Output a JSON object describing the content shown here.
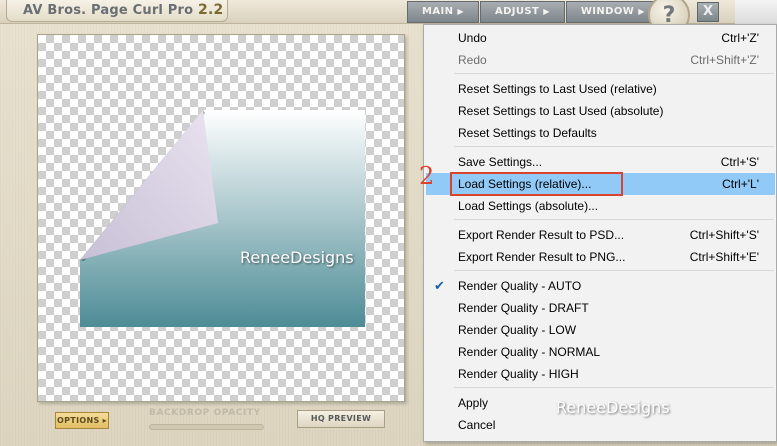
{
  "app": {
    "title": "AV Bros. Page Curl Pro",
    "version": "2.2",
    "menus": [
      {
        "label": "MAIN",
        "arrow": "▶"
      },
      {
        "label": "ADJUST",
        "arrow": "▶"
      },
      {
        "label": "WINDOW",
        "arrow": "▶"
      }
    ],
    "help_glyph": "?",
    "close_glyph": "X"
  },
  "canvas": {
    "watermark": "ReneeDesigns",
    "gradient_top": "#ffffff",
    "gradient_bottom": "#4e8c96",
    "curl_color": "#e9e2ef"
  },
  "bottom_bar": {
    "options_label": "OPTIONS",
    "options_arrow": "▸",
    "backdrop_opacity_label": "BACKDROP OPACITY",
    "hq_preview_label": "HQ PREVIEW"
  },
  "context_menu": {
    "items": [
      {
        "label": "Undo",
        "shortcut": "Ctrl+'Z'",
        "disabled": false
      },
      {
        "label": "Redo",
        "shortcut": "Ctrl+Shift+'Z'",
        "disabled": true
      },
      {
        "label": "Reset Settings to Last Used (relative)",
        "shortcut": ""
      },
      {
        "label": "Reset Settings to Last Used (absolute)",
        "shortcut": ""
      },
      {
        "label": "Reset Settings to Defaults",
        "shortcut": ""
      },
      {
        "label": "Save Settings...",
        "shortcut": "Ctrl+'S'"
      },
      {
        "label": "Load Settings (relative)...",
        "shortcut": "Ctrl+'L'",
        "highlighted": true
      },
      {
        "label": "Load Settings (absolute)...",
        "shortcut": ""
      },
      {
        "label": "Export Render Result to PSD...",
        "shortcut": "Ctrl+Shift+'S'"
      },
      {
        "label": "Export Render Result to PNG...",
        "shortcut": "Ctrl+Shift+'E'"
      },
      {
        "label": "Render Quality - AUTO",
        "shortcut": "",
        "checked": true
      },
      {
        "label": "Render Quality - DRAFT",
        "shortcut": ""
      },
      {
        "label": "Render Quality - LOW",
        "shortcut": ""
      },
      {
        "label": "Render Quality - NORMAL",
        "shortcut": ""
      },
      {
        "label": "Render Quality - HIGH",
        "shortcut": ""
      },
      {
        "label": "Apply",
        "shortcut": ""
      },
      {
        "label": "Cancel",
        "shortcut": ""
      }
    ],
    "check_glyph": "✔",
    "highlight_color": "#91c9f7"
  },
  "annotation": {
    "step_number": "2",
    "color": "#d84430",
    "watermark": "ReneeDesigns"
  }
}
